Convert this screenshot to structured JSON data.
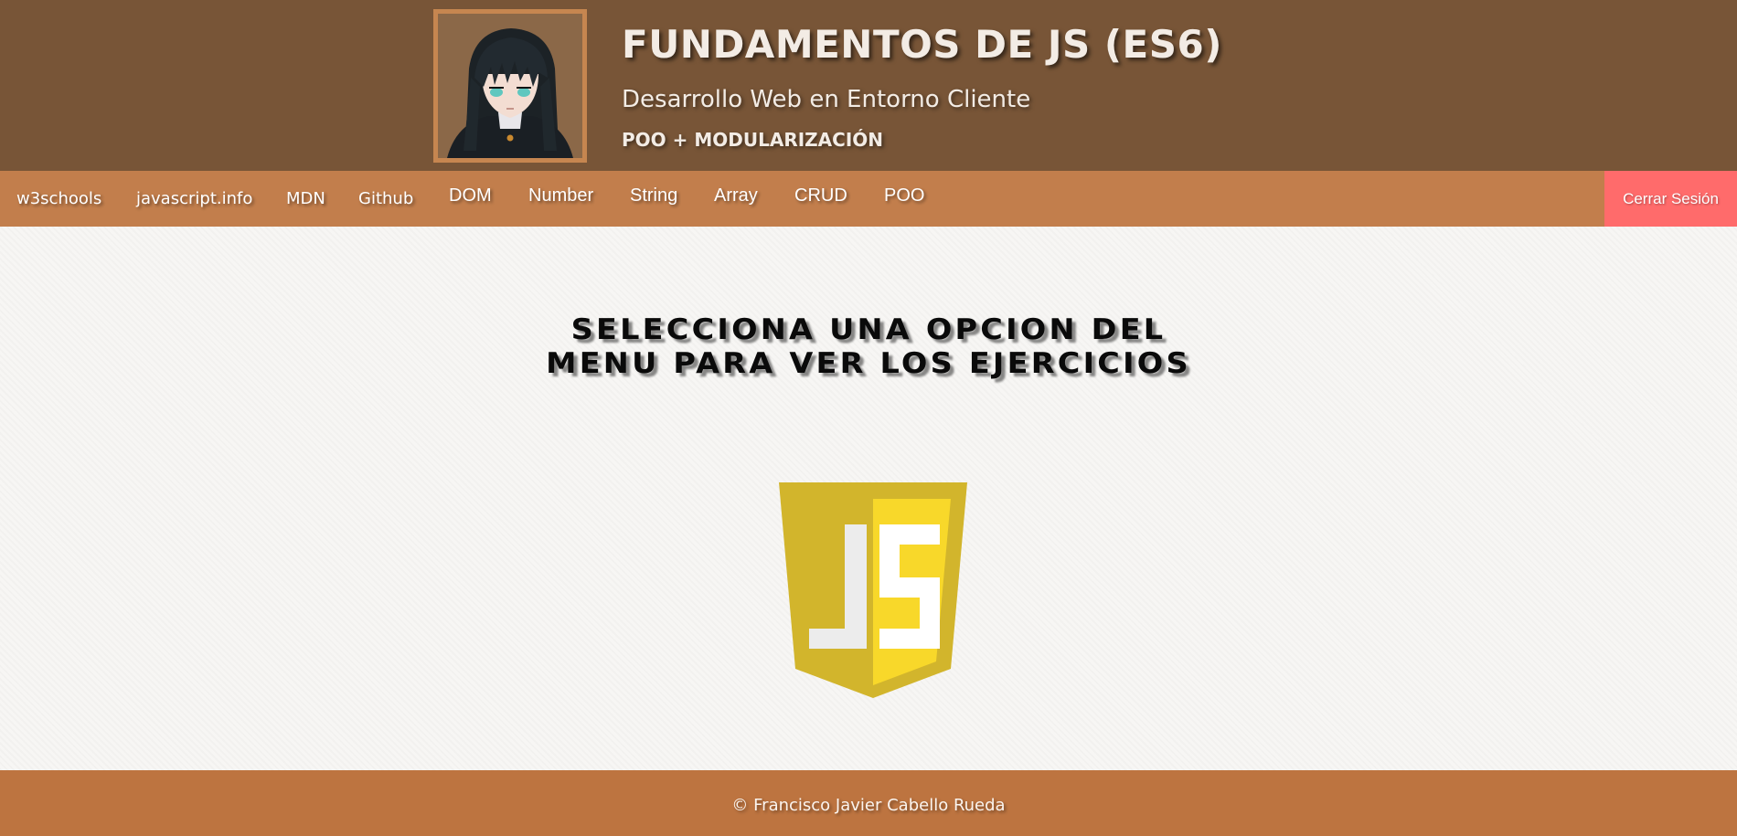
{
  "header": {
    "title": "FUNDAMENTOS DE JS (ES6)",
    "subtitle": "Desarrollo Web en Entorno Cliente",
    "subtitle2": "POO + MODULARIZACIÓN",
    "avatar_icon": "anime-character-avatar"
  },
  "nav": {
    "items": [
      {
        "label": "w3schools"
      },
      {
        "label": "javascript.info"
      },
      {
        "label": "MDN"
      },
      {
        "label": "Github"
      },
      {
        "label": "DOM"
      },
      {
        "label": "Number"
      },
      {
        "label": "String"
      },
      {
        "label": "Array"
      },
      {
        "label": "CRUD"
      },
      {
        "label": "POO"
      }
    ],
    "logout_label": "Cerrar Sesión"
  },
  "main": {
    "heading": "SELECCIONA UNA OPCION DEL MENU PARA VER LOS EJERCICIOS",
    "logo_icon": "js-shield-icon"
  },
  "footer": {
    "text": "© Francisco Javier Cabello Rueda"
  },
  "colors": {
    "header_bg": "#785537",
    "nav_bg": "#c27e4c",
    "logout_bg": "#ff6b6b",
    "footer_bg": "#bd7440",
    "js_yellow_dark": "#d2b52c",
    "js_yellow_light": "#f8d82a"
  }
}
